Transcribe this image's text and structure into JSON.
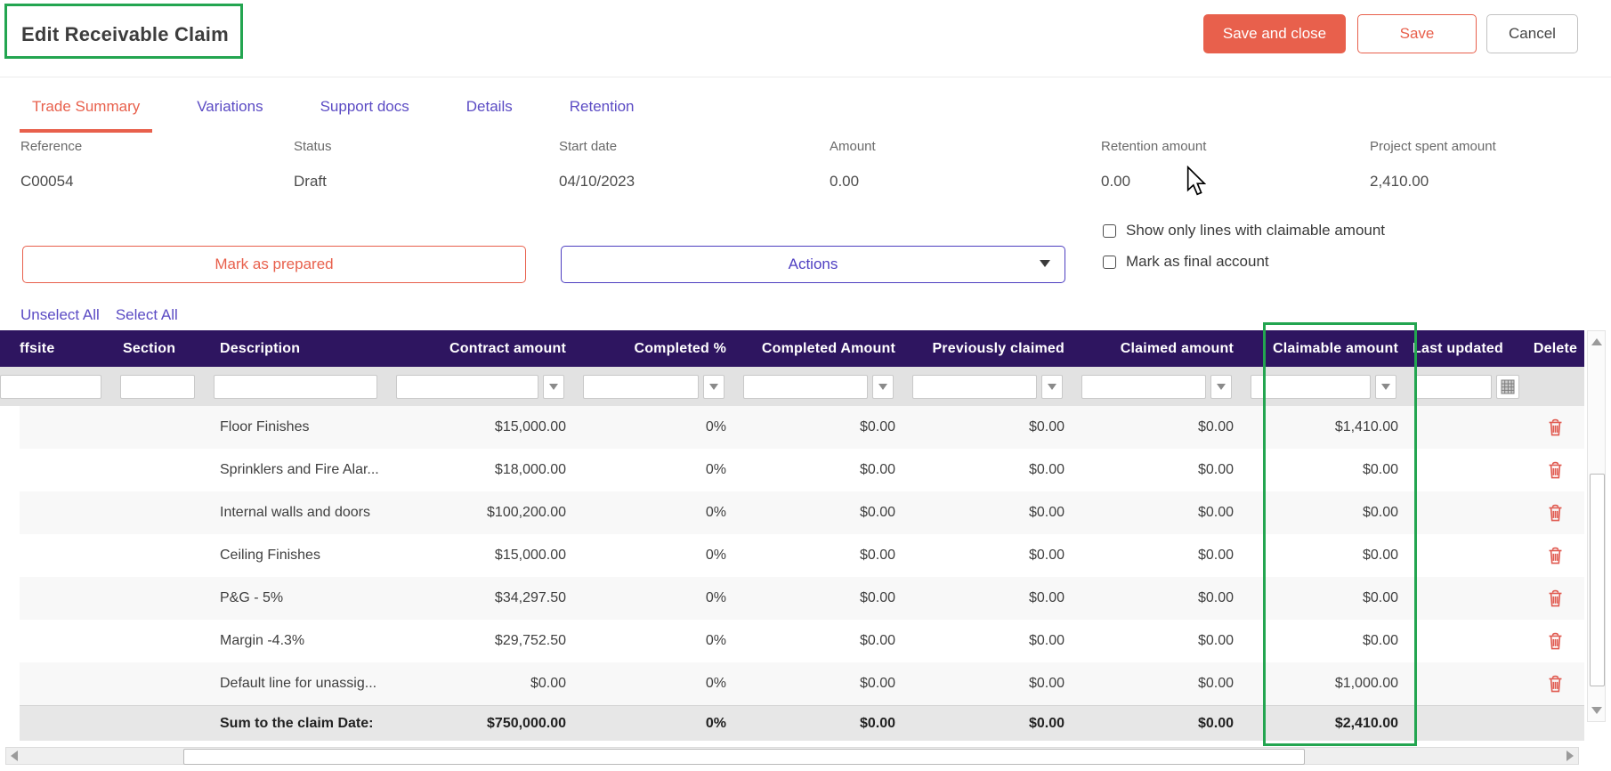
{
  "header": {
    "title": "Edit Receivable Claim",
    "save_and_close_label": "Save and close",
    "save_label": "Save",
    "cancel_label": "Cancel"
  },
  "tabs": [
    {
      "label": "Trade Summary",
      "active": true
    },
    {
      "label": "Variations",
      "active": false
    },
    {
      "label": "Support docs",
      "active": false
    },
    {
      "label": "Details",
      "active": false
    },
    {
      "label": "Retention",
      "active": false
    }
  ],
  "summary_fields": [
    {
      "label": "Reference",
      "value": "C00054"
    },
    {
      "label": "Status",
      "value": "Draft"
    },
    {
      "label": "Start date",
      "value": "04/10/2023"
    },
    {
      "label": "Amount",
      "value": "0.00"
    },
    {
      "label": "Retention amount",
      "value": "0.00"
    },
    {
      "label": "Project spent amount",
      "value": "2,410.00"
    }
  ],
  "actions_row": {
    "mark_as_prepared_label": "Mark as prepared",
    "actions_label": "Actions"
  },
  "checkboxes": [
    {
      "label": "Show only lines with claimable amount",
      "checked": false
    },
    {
      "label": "Mark as final account",
      "checked": false
    }
  ],
  "selection_links": {
    "unselect_all": "Unselect All",
    "select_all": "Select All"
  },
  "table": {
    "columns": [
      "ffsite",
      "Section",
      "Description",
      "Contract amount",
      "Completed %",
      "Completed Amount",
      "Previously claimed",
      "Claimed amount",
      "Claimable amount",
      "Last updated",
      "Delete"
    ],
    "rows": [
      {
        "offsite": "",
        "section": "",
        "description": "Floor Finishes",
        "contract_amount": "$15,000.00",
        "completed_pct": "0%",
        "completed_amount": "$0.00",
        "previously_claimed": "$0.00",
        "claimed_amount": "$0.00",
        "claimable_amount": "$1,410.00",
        "last_updated": ""
      },
      {
        "offsite": "",
        "section": "",
        "description": "Sprinklers and Fire Alar...",
        "contract_amount": "$18,000.00",
        "completed_pct": "0%",
        "completed_amount": "$0.00",
        "previously_claimed": "$0.00",
        "claimed_amount": "$0.00",
        "claimable_amount": "$0.00",
        "last_updated": ""
      },
      {
        "offsite": "",
        "section": "",
        "description": "Internal walls and doors",
        "contract_amount": "$100,200.00",
        "completed_pct": "0%",
        "completed_amount": "$0.00",
        "previously_claimed": "$0.00",
        "claimed_amount": "$0.00",
        "claimable_amount": "$0.00",
        "last_updated": ""
      },
      {
        "offsite": "",
        "section": "",
        "description": "Ceiling Finishes",
        "contract_amount": "$15,000.00",
        "completed_pct": "0%",
        "completed_amount": "$0.00",
        "previously_claimed": "$0.00",
        "claimed_amount": "$0.00",
        "claimable_amount": "$0.00",
        "last_updated": ""
      },
      {
        "offsite": "",
        "section": "",
        "description": "P&G - 5%",
        "contract_amount": "$34,297.50",
        "completed_pct": "0%",
        "completed_amount": "$0.00",
        "previously_claimed": "$0.00",
        "claimed_amount": "$0.00",
        "claimable_amount": "$0.00",
        "last_updated": ""
      },
      {
        "offsite": "",
        "section": "",
        "description": "Margin -4.3%",
        "contract_amount": "$29,752.50",
        "completed_pct": "0%",
        "completed_amount": "$0.00",
        "previously_claimed": "$0.00",
        "claimed_amount": "$0.00",
        "claimable_amount": "$0.00",
        "last_updated": ""
      },
      {
        "offsite": "",
        "section": "",
        "description": "Default line for unassig...",
        "contract_amount": "$0.00",
        "completed_pct": "0%",
        "completed_amount": "$0.00",
        "previously_claimed": "$0.00",
        "claimed_amount": "$0.00",
        "claimable_amount": "$1,000.00",
        "last_updated": ""
      }
    ],
    "sum_row": {
      "description": "Sum to the claim Date:",
      "contract_amount": "$750,000.00",
      "completed_pct": "0%",
      "completed_amount": "$0.00",
      "previously_claimed": "$0.00",
      "claimed_amount": "$0.00",
      "claimable_amount": "$2,410.00"
    }
  },
  "icons": {
    "actions_caret": "caret-down",
    "filter_caret": "caret-down",
    "last_updated_filter": "calendar-grid",
    "row_delete": "trash-can",
    "scrollbar": [
      "arrow-up",
      "arrow-down",
      "arrow-left",
      "arrow-right"
    ]
  },
  "colors": {
    "accent_red": "#e8604c",
    "accent_purple": "#5b4bc4",
    "table_header_bg": "#2e1560",
    "annotation_green": "#23a550",
    "delete_red": "#e05a50",
    "filter_row_bg": "#e2e2e2",
    "row_alt_bg": "#f8f8f8",
    "sum_row_bg": "#e7e7e7"
  }
}
